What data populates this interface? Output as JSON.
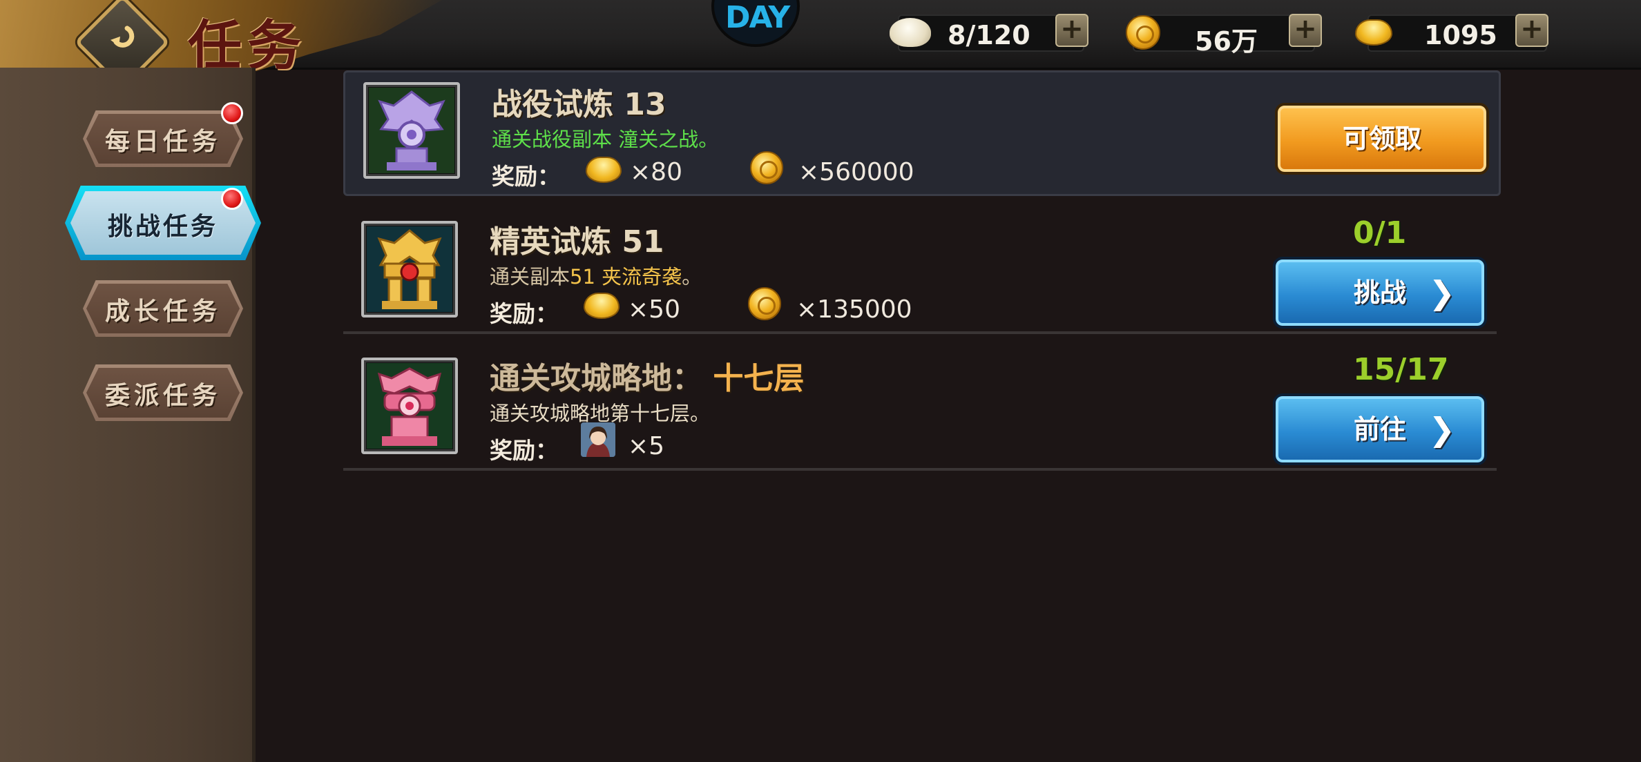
{
  "header": {
    "title": "任务",
    "center_logo_text": "DAY",
    "resources": [
      {
        "icon": "stamina-bun-icon",
        "value": "8/120"
      },
      {
        "icon": "gold-coin-icon",
        "value": "56万"
      },
      {
        "icon": "gold-ingot-icon",
        "value": "1095"
      }
    ]
  },
  "sidebar": {
    "items": [
      {
        "label": "每日任务",
        "active": false,
        "badge": true
      },
      {
        "label": "挑战任务",
        "active": true,
        "badge": true
      },
      {
        "label": "成长任务",
        "active": false,
        "badge": false
      },
      {
        "label": "委派任务",
        "active": false,
        "badge": false
      }
    ]
  },
  "tasks": [
    {
      "name": "战役试炼 13",
      "desc": "通关战役副本 潼关之战。",
      "desc_color": "#5ee04a",
      "reward_label": "奖励：",
      "rewards": [
        {
          "icon": "gold-ingot-icon",
          "amount": "×80"
        },
        {
          "icon": "gold-coin-icon",
          "amount": "×560000"
        }
      ],
      "button": "可领取",
      "button_style": "orange",
      "icon": "purple-totem-icon"
    },
    {
      "name": "精英试炼 51",
      "desc_prefix": "通关副本",
      "desc_highlight": "51 夹流奇袭",
      "desc_suffix": "。",
      "reward_label": "奖励：",
      "rewards": [
        {
          "icon": "gold-ingot-icon",
          "amount": "×50"
        },
        {
          "icon": "gold-coin-icon",
          "amount": "×135000"
        }
      ],
      "progress": "0/1",
      "button": "挑战",
      "button_style": "blue",
      "icon": "golden-totem-icon"
    },
    {
      "name_prefix": "通关攻城略地：",
      "name_highlight": "十七层",
      "desc": "通关攻城略地第十七层。",
      "reward_label": "奖励：",
      "rewards": [
        {
          "icon": "hero-portrait-icon",
          "amount": "×5"
        }
      ],
      "progress": "15/17",
      "button": "前往",
      "button_style": "blue",
      "icon": "pink-totem-icon"
    }
  ],
  "colors": {
    "progress_green": "#9ccf2b",
    "highlight_gold": "#f4b24e",
    "active_tab_cyan": "#15dff5"
  }
}
